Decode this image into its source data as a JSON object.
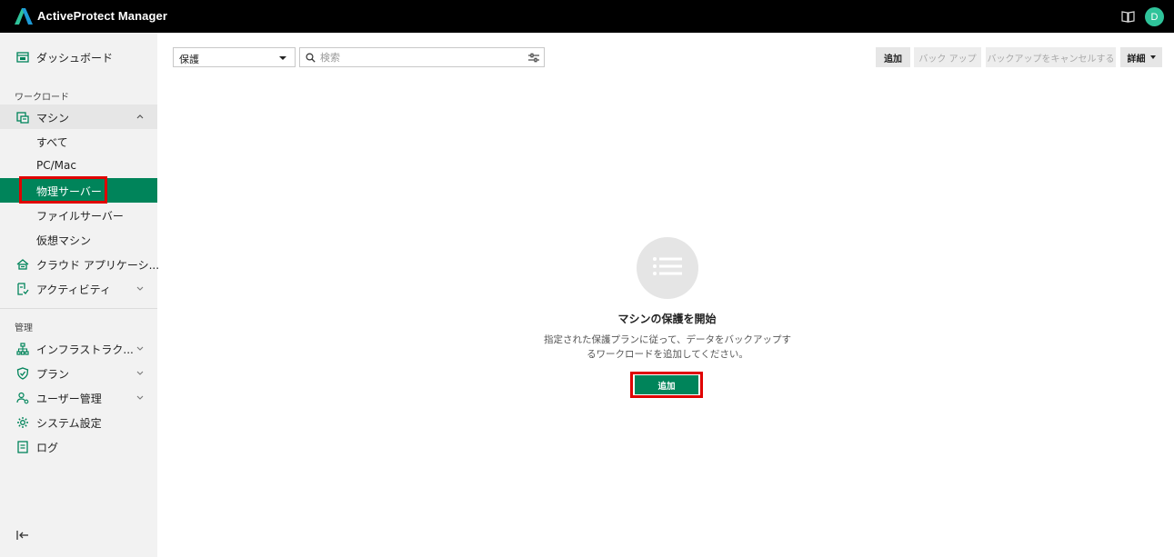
{
  "app": {
    "title": "ActiveProtect Manager",
    "avatar_initial": "D",
    "colors": {
      "accent": "#00845a",
      "avatar": "#2fc39a",
      "highlight": "#e00000"
    }
  },
  "sidebar": {
    "dashboard": {
      "label": "ダッシュボード",
      "icon": "dashboard-icon"
    },
    "workload_section": "ワークロード",
    "machine": {
      "label": "マシン",
      "icon": "machine-icon",
      "expanded": true
    },
    "machine_sub": [
      "すべて",
      "PC/Mac",
      "物理サーバー",
      "ファイルサーバー",
      "仮想マシン"
    ],
    "active_sub": "物理サーバー",
    "cloud_apps": {
      "label": "クラウド アプリケーシ...",
      "icon": "cloud-app-icon"
    },
    "activity": {
      "label": "アクティビティ",
      "icon": "activity-icon"
    },
    "manage_section": "管理",
    "infrastructure": {
      "label": "インフラストラク...",
      "icon": "infrastructure-icon"
    },
    "plan": {
      "label": "プラン",
      "icon": "shield-check-icon"
    },
    "user_management": {
      "label": "ユーザー管理",
      "icon": "user-manage-icon"
    },
    "system_settings": {
      "label": "システム設定",
      "icon": "gear-icon"
    },
    "log": {
      "label": "ログ",
      "icon": "log-icon"
    }
  },
  "toolbar": {
    "filter_value": "保護",
    "search_placeholder": "検索",
    "add_label": "追加",
    "backup_label": "バック アップ",
    "cancel_backup_label": "バックアップをキャンセルする",
    "details_label": "詳細"
  },
  "empty_state": {
    "title": "マシンの保護を開始",
    "desc_line1": "指定された保護プランに従って、データをバックアップす",
    "desc_line2": "るワークロードを追加してください。",
    "add_label": "追加"
  }
}
